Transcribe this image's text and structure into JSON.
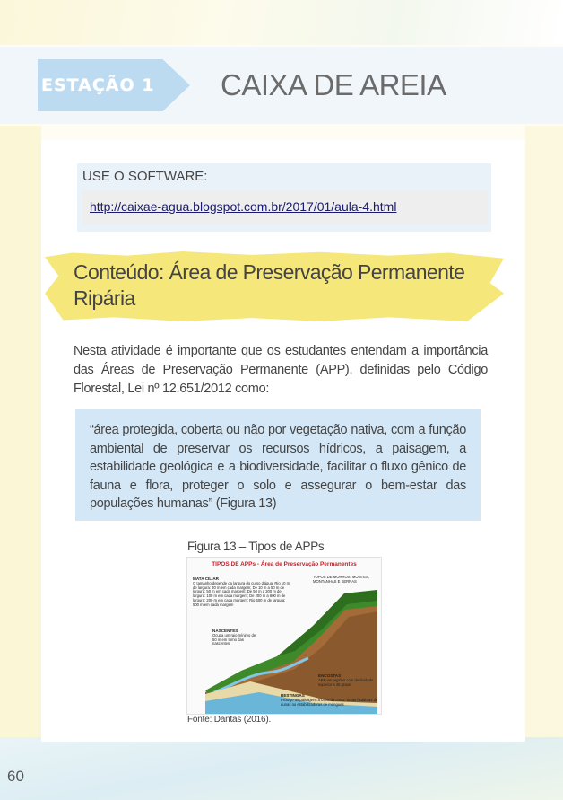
{
  "header": {
    "station_label": "ESTAÇÃO 1",
    "title": "CAIXA DE AREIA"
  },
  "software": {
    "label": "USE O SOFTWARE:",
    "url": "http://caixae-agua.blogspot.com.br/2017/01/aula-4.html"
  },
  "content": {
    "title": "Conteúdo: Área de Preservação Permanente Ripária",
    "intro": "Nesta atividade é importante que os estudantes entendam a importância das Áreas de Preservação Permanente (APP), definidas pelo Código Florestal, Lei nº 12.651/2012 como:",
    "quote": "“área protegida, coberta ou não por vegetação nativa, com a função ambiental de preservar os recursos hídricos, a paisagem, a estabilidade geológica e a biodiversidade, facilitar o fluxo gênico de fauna e flora, proteger o solo e assegurar o bem-estar das populações humanas” (Figura 13)"
  },
  "figure": {
    "caption": "Figura 13 – Tipos de APPs",
    "image_title": "TIPOS DE APPs - Área de Preservação Permanentes",
    "labels": {
      "mata_ciliar": "MATA CILIAR",
      "mata_ciliar_text": "O tamanho depende da largura do curso d'água: Rio 10 m de largura: 30 m em cada margem; De 10 m a 50 m de largura: 50 m em cada margem; De 50 m a 200 m de largura: 100 m em cada margem; De 200 m a 600 m de largura: 200 m em cada margem; Rio 600 m de largura: 500 m em cada margem",
      "topos": "TOPOS DE MORROS, MONTES, MONTANHAS E SERRAS",
      "nascentes": "NASCENTES",
      "nascentes_text": "Ocupa um raio mínimo de 50 m em torno das nascentes",
      "encostas": "ENCOSTAS",
      "encostas_text": "APP em regiões com declividade superior a 45 graus",
      "restingas": "RESTINGAS",
      "restingas_text": "Protege as paisagens à beira da costa: áreas fixadoras de dunas ou estabilizadoras de mangues"
    },
    "source": "Fonte: Dantas (2016)."
  },
  "page": {
    "number": "60"
  }
}
